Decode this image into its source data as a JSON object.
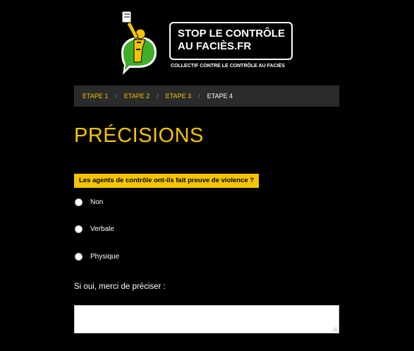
{
  "header": {
    "logo_line1": "STOP LE CONTRÔLE",
    "logo_line2": "AU FACIÈS.FR",
    "tagline": "COLLECTIF CONTRE LE CONTRÔLE AU FACIÈS"
  },
  "breadcrumb": {
    "items": [
      {
        "label": "ETAPE 1"
      },
      {
        "label": "ETAPE 2"
      },
      {
        "label": "ETAPE 3"
      },
      {
        "label": "ETAPE 4"
      }
    ],
    "separator": "/"
  },
  "page": {
    "title": "PRÉCISIONS"
  },
  "question": {
    "label": "Les agents de contrôle ont-ils fait preuve de violence ?",
    "options": [
      {
        "label": "Non"
      },
      {
        "label": "Verbale"
      },
      {
        "label": "Physique"
      }
    ]
  },
  "details": {
    "label": "Si oui, merci de préciser :",
    "value": ""
  },
  "colors": {
    "accent": "#f5c400",
    "background": "#000000",
    "breadcrumb_bg": "#2b2b2b",
    "logo_green": "#3fae2a"
  }
}
